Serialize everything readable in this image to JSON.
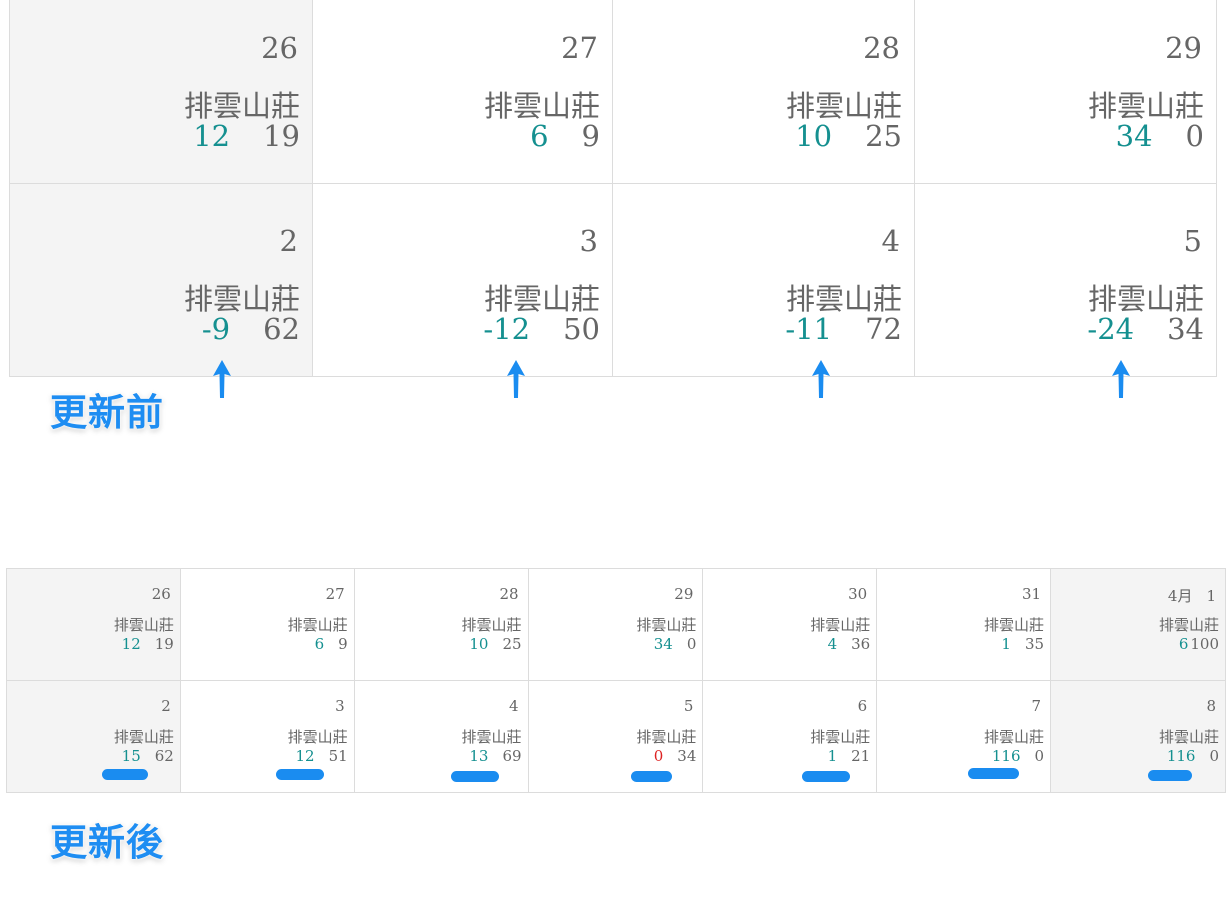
{
  "before": {
    "caption": "更新前",
    "rows": [
      [
        {
          "day": "26",
          "place": "排雲山莊",
          "a": "12",
          "b": "19",
          "weekend": true
        },
        {
          "day": "27",
          "place": "排雲山莊",
          "a": "6",
          "b": "9",
          "weekend": false
        },
        {
          "day": "28",
          "place": "排雲山莊",
          "a": "10",
          "b": "25",
          "weekend": false
        },
        {
          "day": "29",
          "place": "排雲山莊",
          "a": "34",
          "b": "0",
          "weekend": false
        }
      ],
      [
        {
          "day": "2",
          "place": "排雲山莊",
          "a": "-9",
          "b": "62",
          "weekend": true
        },
        {
          "day": "3",
          "place": "排雲山莊",
          "a": "-12",
          "b": "50",
          "weekend": false
        },
        {
          "day": "4",
          "place": "排雲山莊",
          "a": "-11",
          "b": "72",
          "weekend": false
        },
        {
          "day": "5",
          "place": "排雲山莊",
          "a": "-24",
          "b": "34",
          "weekend": false
        }
      ]
    ]
  },
  "after": {
    "caption": "更新後",
    "rows": [
      [
        {
          "day": "26",
          "place": "排雲山莊",
          "a": "12",
          "b": "19",
          "weekend": true
        },
        {
          "day": "27",
          "place": "排雲山莊",
          "a": "6",
          "b": "9",
          "weekend": false
        },
        {
          "day": "28",
          "place": "排雲山莊",
          "a": "10",
          "b": "25",
          "weekend": false
        },
        {
          "day": "29",
          "place": "排雲山莊",
          "a": "34",
          "b": "0",
          "weekend": false
        },
        {
          "day": "30",
          "place": "排雲山莊",
          "a": "4",
          "b": "36",
          "weekend": false
        },
        {
          "day": "31",
          "place": "排雲山莊",
          "a": "1",
          "b": "35",
          "weekend": false
        },
        {
          "day": "1",
          "month": "4月",
          "place": "排雲山莊",
          "a": "6",
          "b": "100",
          "weekend": true
        }
      ],
      [
        {
          "day": "2",
          "place": "排雲山莊",
          "a": "15",
          "b": "62",
          "weekend": true
        },
        {
          "day": "3",
          "place": "排雲山莊",
          "a": "12",
          "b": "51",
          "weekend": false
        },
        {
          "day": "4",
          "place": "排雲山莊",
          "a": "13",
          "b": "69",
          "weekend": false
        },
        {
          "day": "5",
          "place": "排雲山莊",
          "a": "0",
          "b": "34",
          "weekend": false
        },
        {
          "day": "6",
          "place": "排雲山莊",
          "a": "1",
          "b": "21",
          "weekend": false
        },
        {
          "day": "7",
          "place": "排雲山莊",
          "a": "116",
          "b": "0",
          "weekend": false
        },
        {
          "day": "8",
          "place": "排雲山莊",
          "a": "116",
          "b": "0",
          "weekend": true
        }
      ]
    ]
  },
  "colors": {
    "available": "#159090",
    "zero": "#dd2222",
    "annotation": "#1e8df2",
    "weekend_bg": "#f4f4f4"
  }
}
